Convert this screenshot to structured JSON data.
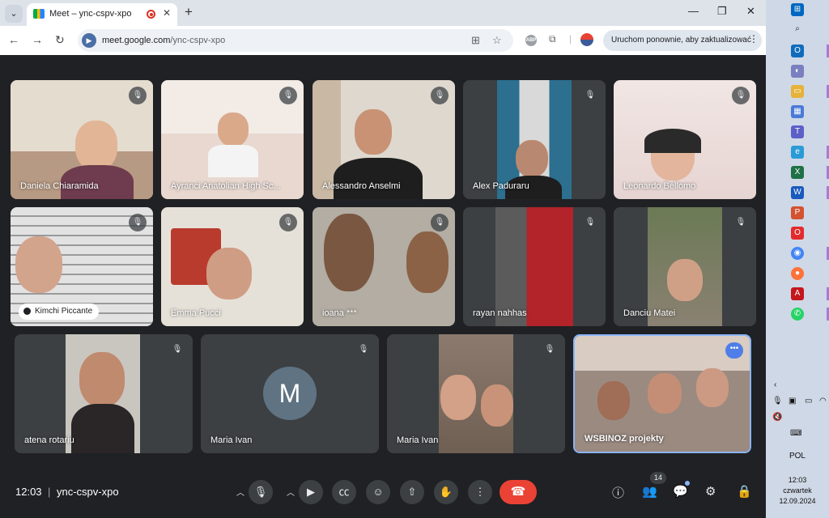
{
  "browser": {
    "tab_title": "Meet – ync-cspv-xpo",
    "url_domain": "meet.google.com",
    "url_path": "/ync-cspv-xpo",
    "update_button": "Uruchom ponownie, aby zaktualizować"
  },
  "participants": [
    {
      "name": "Daniela Chiaramida",
      "muted": true
    },
    {
      "name": "Ayranci Anatolian High Sc...",
      "muted": true
    },
    {
      "name": "Alessandro Anselmi",
      "muted": true
    },
    {
      "name": "Alex Paduraru",
      "muted": true
    },
    {
      "name": "Leonardo Bellomo",
      "muted": true
    },
    {
      "name": "Kimchi Piccante",
      "muted": true,
      "pinned_style": true
    },
    {
      "name": "Emma Pucci",
      "muted": true
    },
    {
      "name": "ioana ***",
      "muted": true
    },
    {
      "name": "rayan nahhas",
      "muted": true
    },
    {
      "name": "Danciu Matei",
      "muted": true
    },
    {
      "name": "atena rotariu",
      "muted": true
    },
    {
      "name": "Maria Ivan",
      "muted": true,
      "avatar_letter": "M"
    },
    {
      "name": "Maria Ivan",
      "muted": true
    },
    {
      "name": "WSBINOZ projekty",
      "muted": false,
      "active_speaker": true
    }
  ],
  "meeting": {
    "time": "12:03",
    "separator": "|",
    "code": "ync-cspv-xpo",
    "people_count": "14"
  },
  "taskbar": {
    "language": "POL",
    "time": "12:03",
    "day": "czwartek",
    "date": "12.09.2024"
  },
  "colors": {
    "meet_bg": "#202124",
    "tile_bg": "#3c4043",
    "end_call": "#ea4335",
    "active_border": "#8ab4f8"
  }
}
